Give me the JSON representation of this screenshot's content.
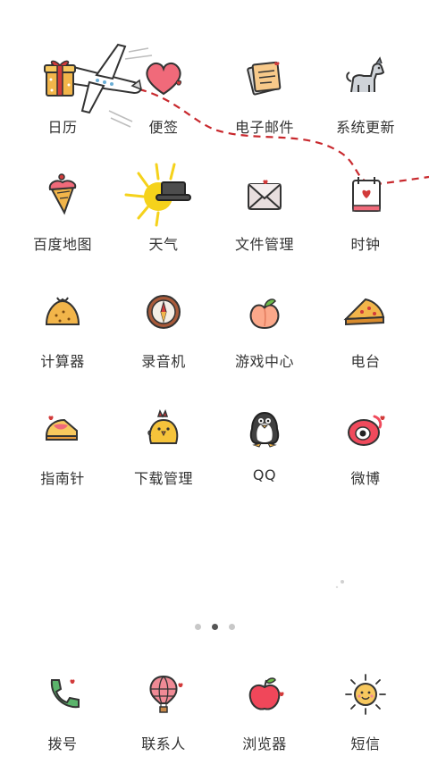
{
  "theme": {
    "accent": "#d23a3a",
    "dash_line": "#c8282d",
    "text": "#333333",
    "outline": "#333333"
  },
  "apps": [
    {
      "label": "日历",
      "icon": "gift-box-icon"
    },
    {
      "label": "便签",
      "icon": "heart-icon"
    },
    {
      "label": "电子邮件",
      "icon": "notepad-icon"
    },
    {
      "label": "系统更新",
      "icon": "dog-icon"
    },
    {
      "label": "百度地图",
      "icon": "ice-cream-cone-icon"
    },
    {
      "label": "天气",
      "icon": "sun-with-hat-icon"
    },
    {
      "label": "文件管理",
      "icon": "envelope-icon"
    },
    {
      "label": "时钟",
      "icon": "calendar-card-icon"
    },
    {
      "label": "计算器",
      "icon": "bun-icon"
    },
    {
      "label": "录音机",
      "icon": "compass-icon"
    },
    {
      "label": "游戏中心",
      "icon": "peach-icon"
    },
    {
      "label": "电台",
      "icon": "pie-slice-icon"
    },
    {
      "label": "指南针",
      "icon": "cake-slice-icon"
    },
    {
      "label": "下载管理",
      "icon": "chick-icon"
    },
    {
      "label": "QQ",
      "icon": "penguin-icon"
    },
    {
      "label": "微博",
      "icon": "weibo-eye-icon"
    }
  ],
  "page_indicator": {
    "count": 3,
    "active": 2
  },
  "dock": [
    {
      "label": "拨号",
      "icon": "phone-icon"
    },
    {
      "label": "联系人",
      "icon": "hot-air-balloon-icon"
    },
    {
      "label": "浏览器",
      "icon": "apple-icon"
    },
    {
      "label": "短信",
      "icon": "sun-face-icon"
    }
  ]
}
